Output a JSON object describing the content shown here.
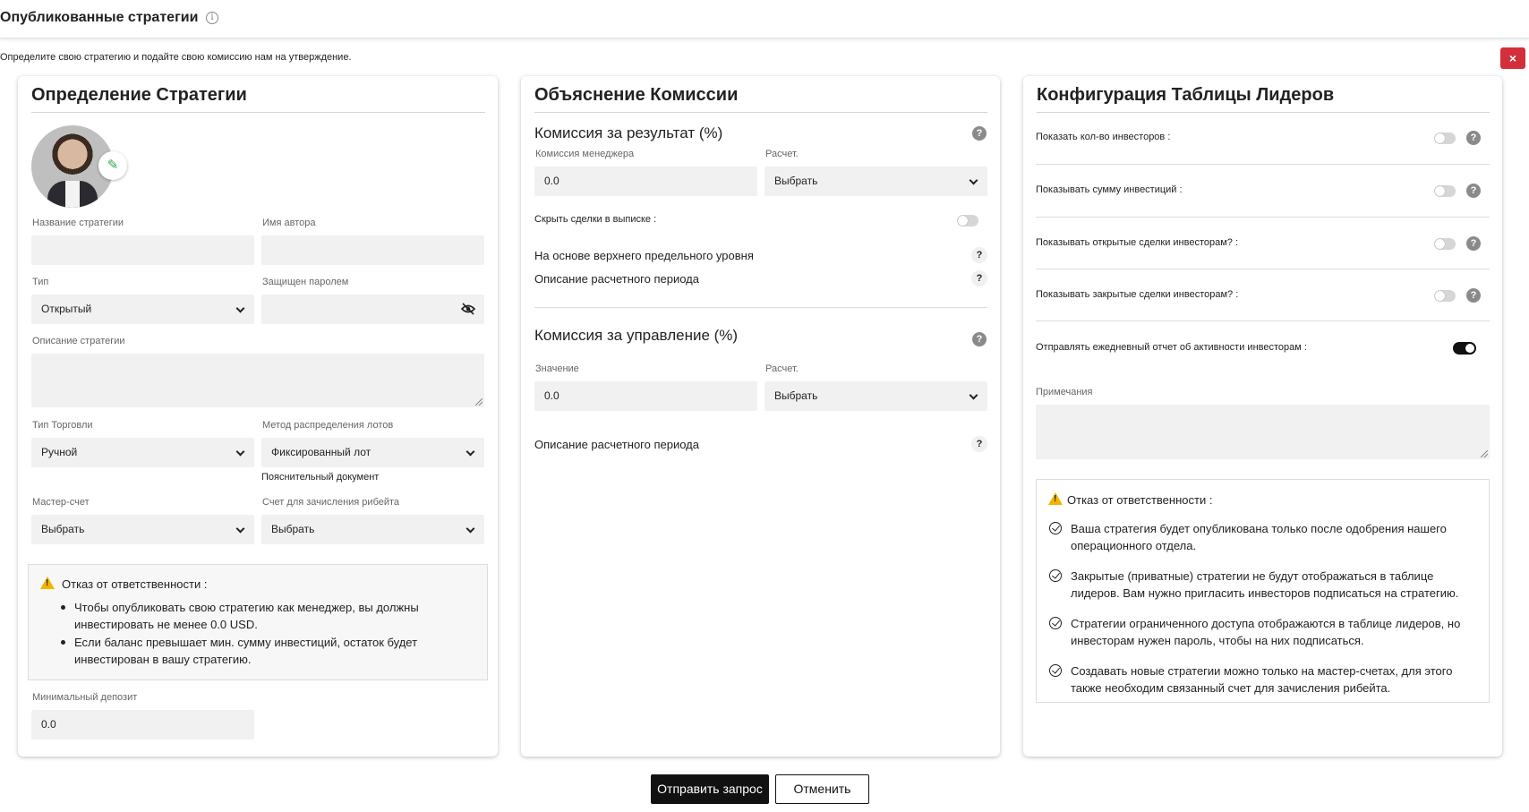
{
  "header": {
    "title": "Опубликованные стратегии",
    "info_icon": "info-icon",
    "subtitle": "Определите свою стратегию и подайте свою комиссию нам на утверждение.",
    "close_label": "×"
  },
  "strategy": {
    "title": "Определение Стратегии",
    "name_label": "Название стратегии",
    "name_value": "",
    "author_label": "Имя автора",
    "author_value": "",
    "type_label": "Тип",
    "type_value": "Открытый",
    "password_label": "Защищен паролем",
    "password_value": "",
    "description_label": "Описание стратегии",
    "trade_type_label": "Тип Торговли",
    "trade_type_value": "Ручной",
    "lot_method_label": "Метод распределения лотов",
    "lot_method_value": "Фиксированный лот",
    "doc_link": "Пояснительный документ",
    "master_label": "Мастер-счет",
    "master_value": "Выбрать",
    "rebate_label": "Счет для зачисления рибейта",
    "rebate_value": "Выбрать",
    "disclaimer_title": "Отказ от ответственности :",
    "disclaimer_items": [
      "Чтобы опубликовать свою стратегию как менеджер, вы должны инвестировать не менее 0.0 USD.",
      "Если баланс превышает мин. сумму инвестиций, остаток будет инвестирован в вашу стратегию."
    ],
    "min_deposit_label": "Минимальный депозит",
    "min_deposit_value": "0.0"
  },
  "commission": {
    "title": "Объяснение Комиссии",
    "perf_title": "Комиссия за результат (%)",
    "manager_label": "Комиссия менеджера",
    "manager_value": "0.0",
    "calc_label": "Расчет.",
    "calc_value": "Выбрать",
    "hide_trades_label": "Скрыть сделки в выписке :",
    "hwm_label": "На основе верхнего предельного уровня",
    "period_desc_label": "Описание расчетного периода",
    "mgmt_title": "Комиссия за управление (%)",
    "value_label": "Значение",
    "mgmt_value": "0.0",
    "mgmt_calc_label": "Расчет.",
    "mgmt_calc_value": "Выбрать",
    "mgmt_period_desc_label": "Описание расчетного периода"
  },
  "leaderboard": {
    "title": "Конфигурация Таблицы Лидеров",
    "toggles": [
      {
        "label": "Показать кол-во инвесторов :",
        "on": false
      },
      {
        "label": "Показывать сумму инвестиций :",
        "on": false
      },
      {
        "label": "Показывать открытые сделки инвесторам? :",
        "on": false
      },
      {
        "label": "Показывать закрытые сделки инвесторам? :",
        "on": false
      },
      {
        "label": "Отправлять ежедневный отчет об активности инвесторам :",
        "on": true
      }
    ],
    "notes_label": "Примечания",
    "disclaimer_title": "Отказ от ответственности :",
    "disclaimer_items": [
      "Ваша стратегия будет опубликована только после одобрения нашего операционного отдела.",
      "Закрытые (приватные) стратегии не будут отображаться в таблице лидеров. Вам нужно пригласить инвесторов подписаться на стратегию.",
      "Стратегии ограниченного доступа отображаются в таблице лидеров, но инвесторам нужен пароль, чтобы на них подписаться.",
      "Создавать новые стратегии можно только на мастер-счетах, для этого также необходим связанный счет для зачисления рибейта."
    ]
  },
  "footer": {
    "submit_label": "Отправить запрос",
    "cancel_label": "Отменить"
  }
}
